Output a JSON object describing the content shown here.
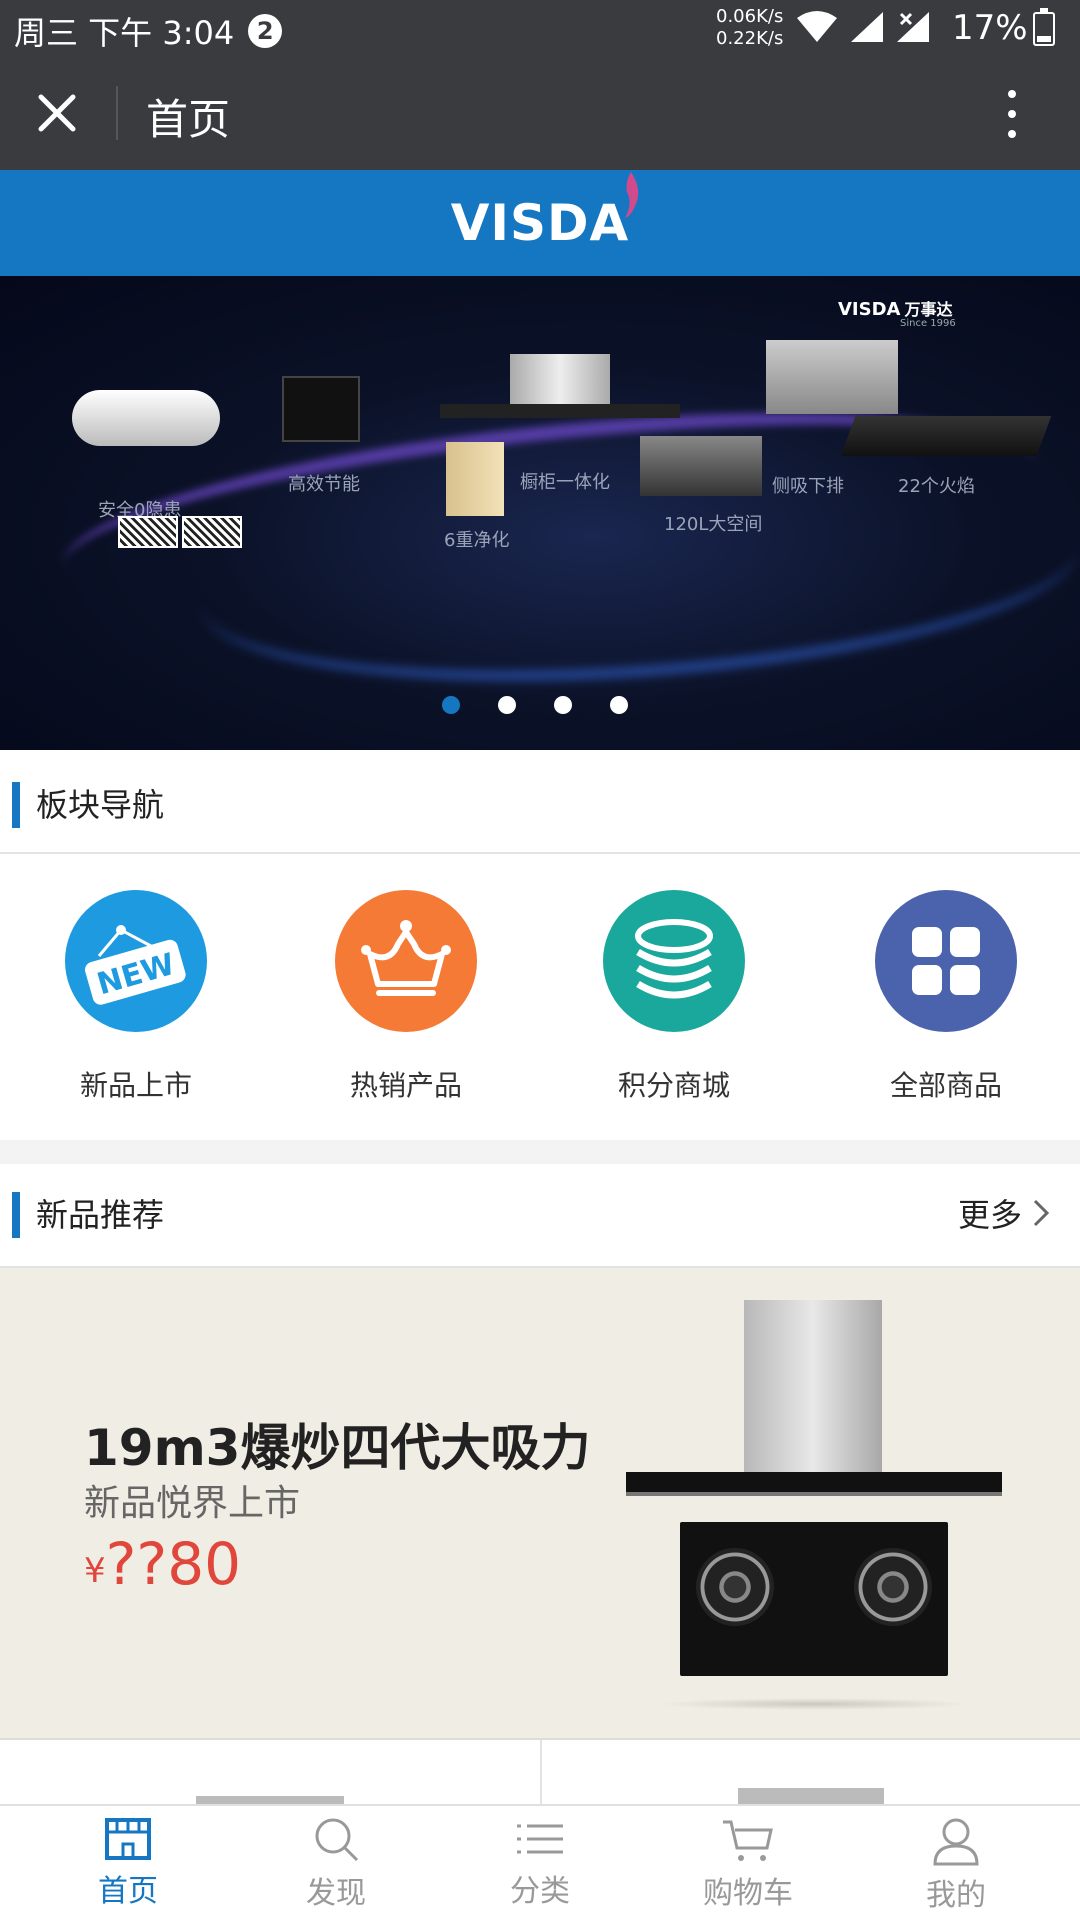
{
  "status_bar": {
    "time": "周三 下午 3:04",
    "notification_count": "2",
    "speed_up": "0.06K/s",
    "speed_down": "0.22K/s",
    "battery": "17%"
  },
  "toolbar": {
    "title": "首页"
  },
  "brand": {
    "logo": "VISDA"
  },
  "banner": {
    "brand": "VISDA",
    "brand_cn": "万事达",
    "since": "Since 1996",
    "products": [
      {
        "label": "安全0隐患"
      },
      {
        "label": "高效节能"
      },
      {
        "label": "橱柜一体化"
      },
      {
        "label": "侧吸下排"
      },
      {
        "label": "6重净化"
      },
      {
        "label": "120L大空间"
      },
      {
        "label": "22个火焰"
      }
    ],
    "slide_count": 4,
    "active_slide": 0
  },
  "nav_section": {
    "title": "板块导航",
    "items": [
      {
        "label": "新品上市",
        "icon": "new-badge-icon",
        "color": "#1e9ae0"
      },
      {
        "label": "热销产品",
        "icon": "crown-icon",
        "color": "#f47a36"
      },
      {
        "label": "积分商城",
        "icon": "coins-icon",
        "color": "#1aa89c"
      },
      {
        "label": "全部商品",
        "icon": "grid-icon",
        "color": "#4b63ad"
      }
    ]
  },
  "new_section": {
    "title": "新品推荐",
    "more": "更多"
  },
  "hero": {
    "title": "19m3爆炒四代大吸力",
    "subtitle": "新品悦界上市",
    "currency": "¥",
    "price": "??80"
  },
  "tabbar": {
    "items": [
      {
        "label": "首页",
        "icon": "home-icon",
        "active": true
      },
      {
        "label": "发现",
        "icon": "search-icon",
        "active": false
      },
      {
        "label": "分类",
        "icon": "list-icon",
        "active": false
      },
      {
        "label": "购物车",
        "icon": "cart-icon",
        "active": false
      },
      {
        "label": "我的",
        "icon": "user-icon",
        "active": false
      }
    ]
  },
  "colors": {
    "accent": "#1577c1",
    "price": "#e0463b",
    "toolbar_bg": "#3a3b3f"
  }
}
